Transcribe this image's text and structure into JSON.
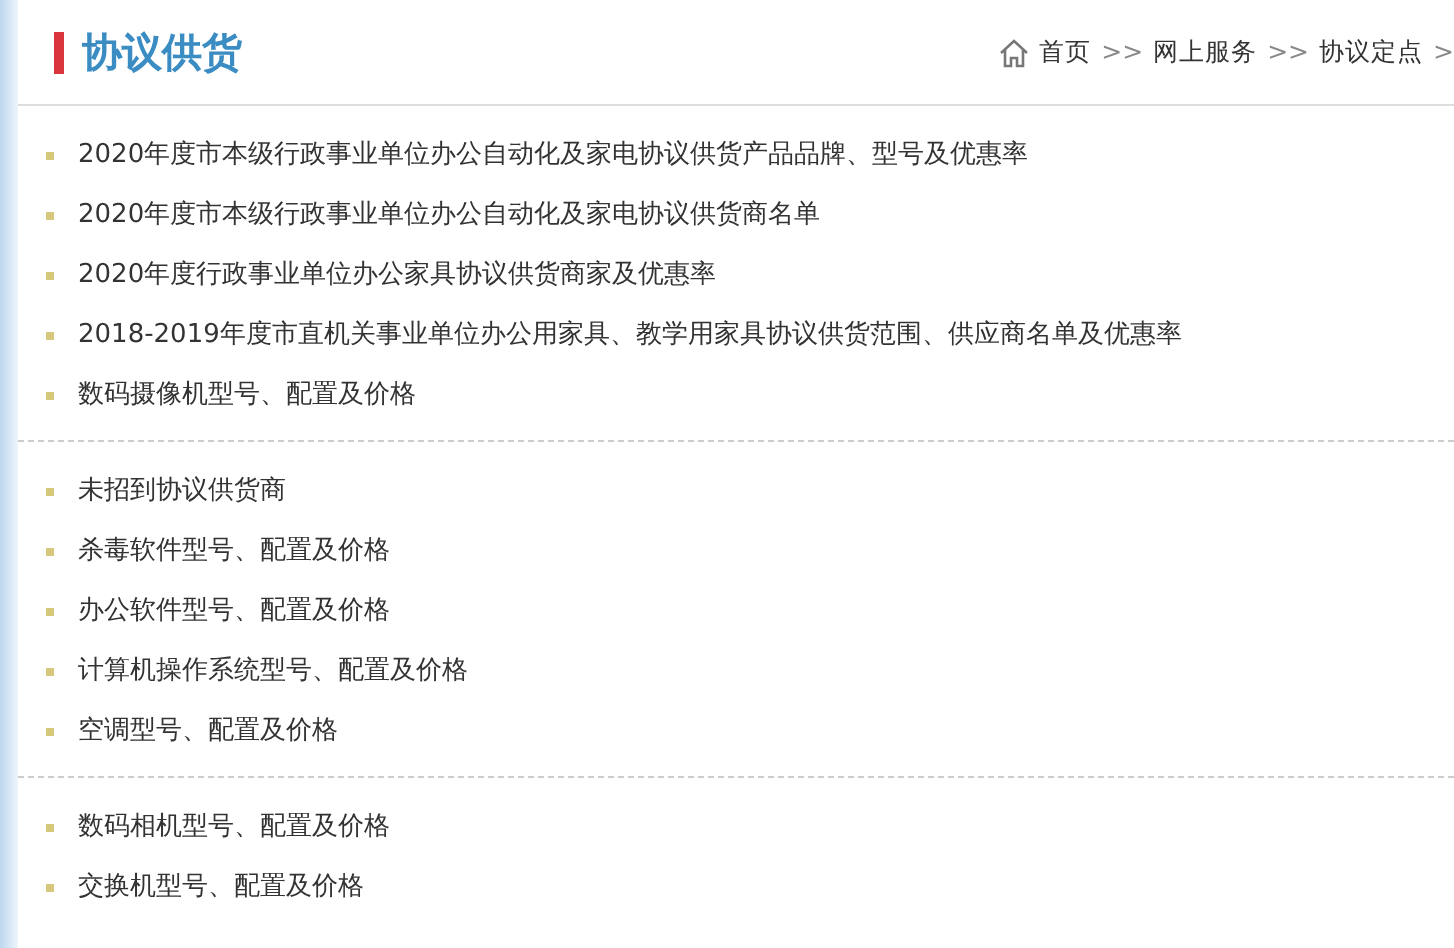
{
  "header": {
    "title": "协议供货",
    "breadcrumb": [
      {
        "label": "首页"
      },
      {
        "label": "网上服务"
      },
      {
        "label": "协议定点"
      }
    ],
    "separators": [
      ">>",
      ">>",
      ">"
    ]
  },
  "groups": [
    {
      "items": [
        "2020年度市本级行政事业单位办公自动化及家电协议供货产品品牌、型号及优惠率",
        "2020年度市本级行政事业单位办公自动化及家电协议供货商名单",
        "2020年度行政事业单位办公家具协议供货商家及优惠率",
        "2018-2019年度市直机关事业单位办公用家具、教学用家具协议供货范围、供应商名单及优惠率",
        "数码摄像机型号、配置及价格"
      ]
    },
    {
      "items": [
        "未招到协议供货商",
        "杀毒软件型号、配置及价格",
        "办公软件型号、配置及价格",
        "计算机操作系统型号、配置及价格",
        "空调型号、配置及价格"
      ]
    },
    {
      "items": [
        "数码相机型号、配置及价格",
        "交换机型号、配置及价格"
      ]
    }
  ]
}
